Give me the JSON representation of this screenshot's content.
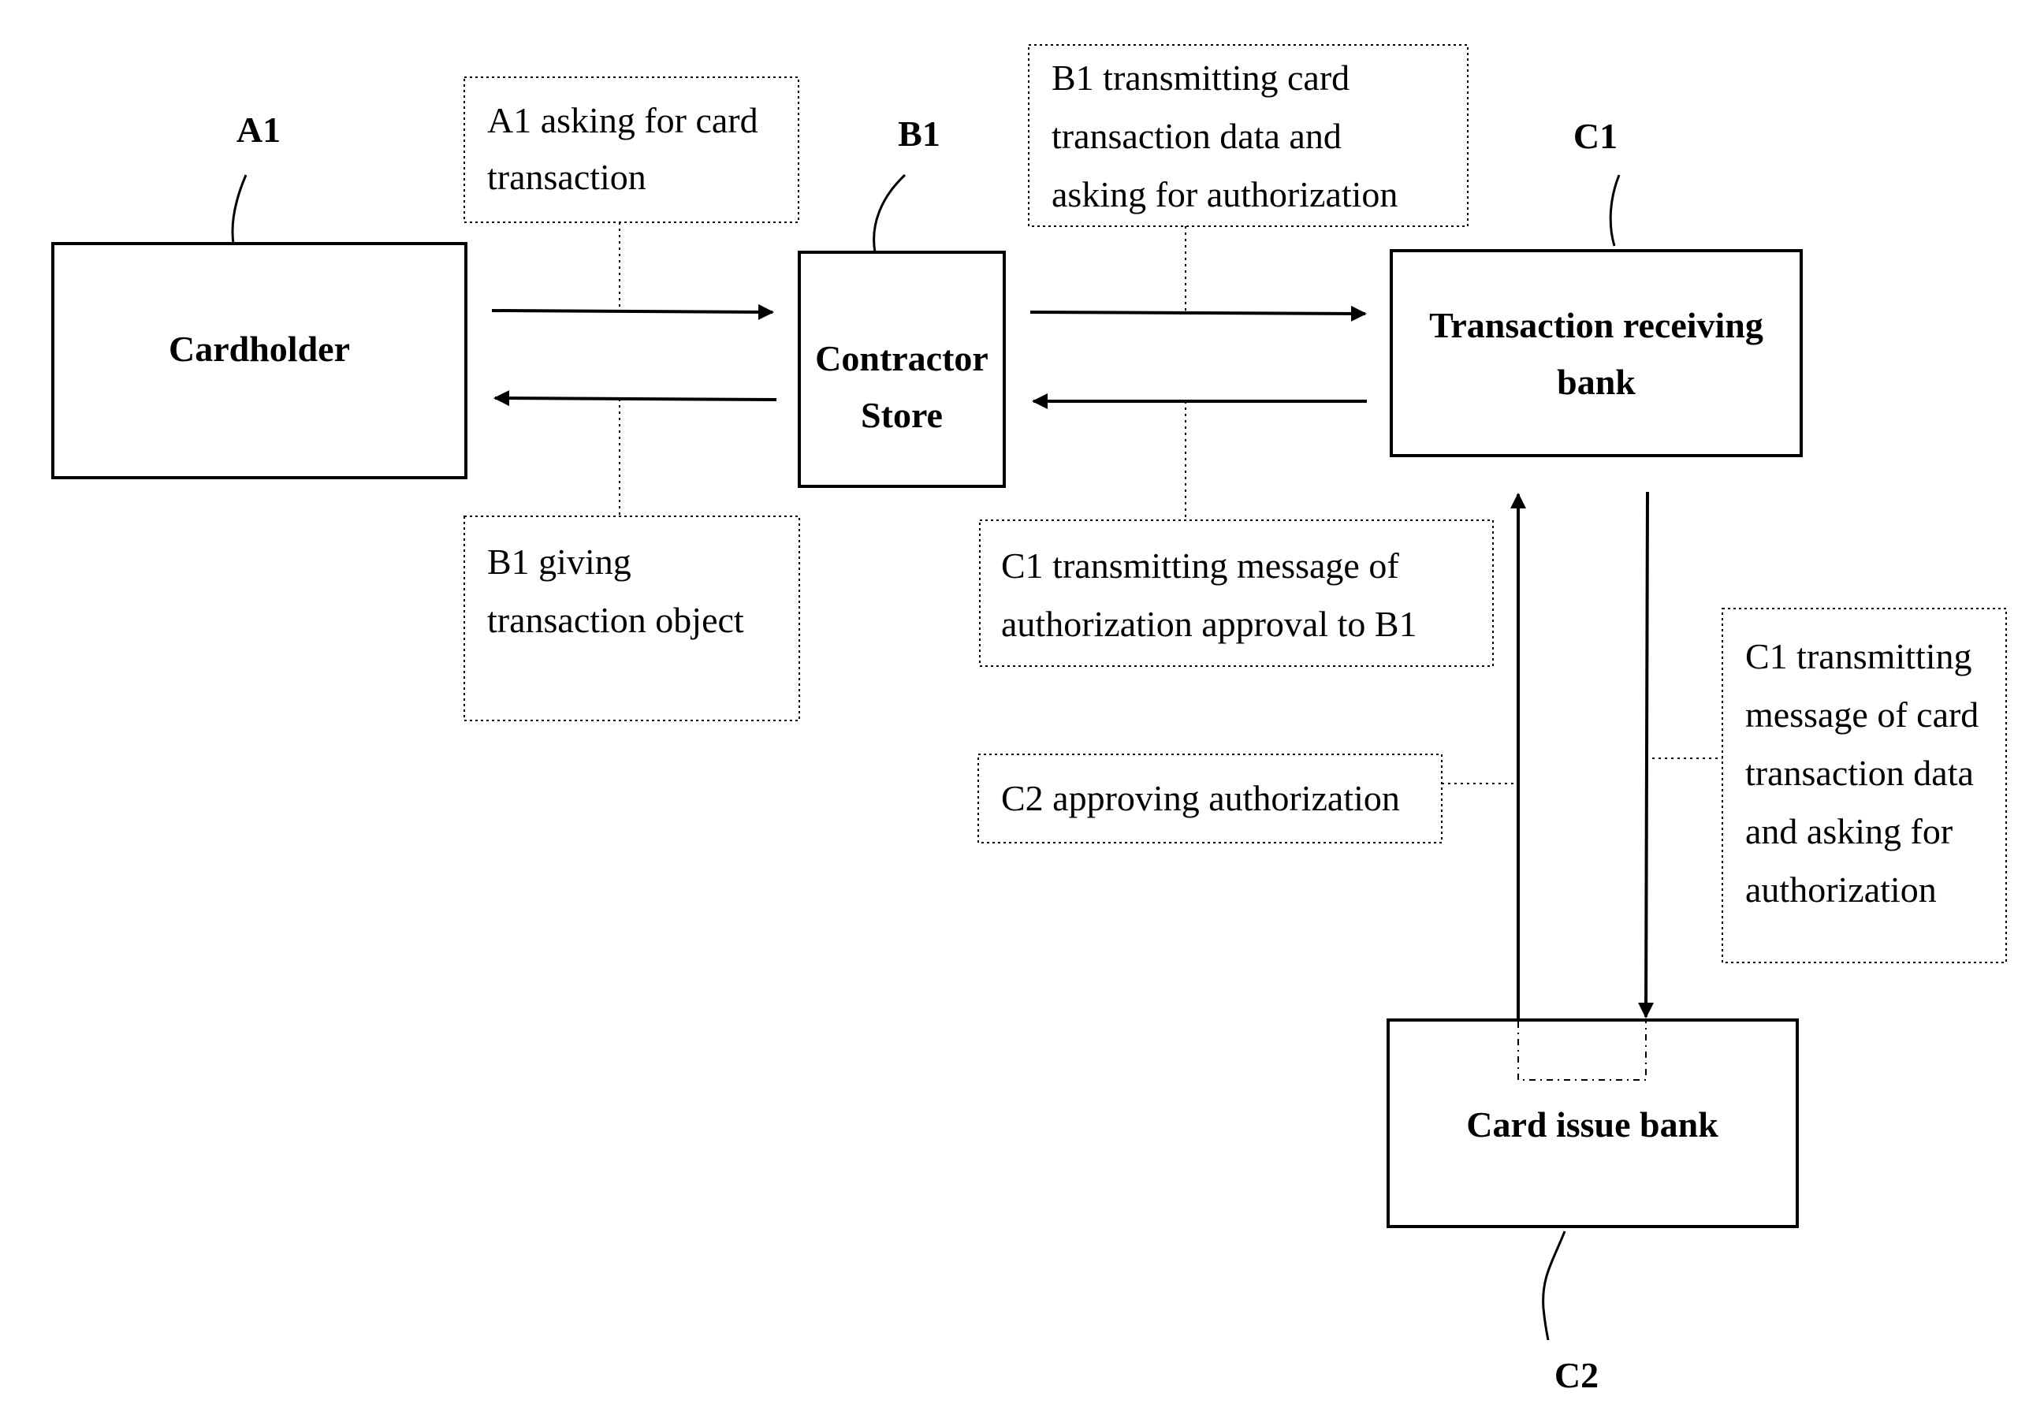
{
  "diagram": {
    "type": "flow",
    "colors": {
      "ink": "#000000",
      "background": "#ffffff"
    },
    "entities": [
      {
        "id": "A1",
        "ref": "A1",
        "lines": [
          "Cardholder"
        ]
      },
      {
        "id": "B1",
        "ref": "B1",
        "lines": [
          "Contractor",
          "Store"
        ]
      },
      {
        "id": "C1",
        "ref": "C1",
        "lines": [
          "Transaction receiving",
          "bank"
        ]
      },
      {
        "id": "C2",
        "ref": "C2",
        "lines": [
          "Card issue bank"
        ]
      }
    ],
    "messages": [
      {
        "id": "m1",
        "from": "A1",
        "to": "B1",
        "lines": [
          "A1 asking for card",
          "transaction"
        ]
      },
      {
        "id": "m2",
        "from": "B1",
        "to": "A1",
        "lines": [
          "B1 giving",
          "transaction object"
        ]
      },
      {
        "id": "m3",
        "from": "B1",
        "to": "C1",
        "lines": [
          "B1 transmitting card",
          "transaction data and",
          "asking for authorization"
        ]
      },
      {
        "id": "m4",
        "from": "C1",
        "to": "B1",
        "lines": [
          "C1 transmitting message of",
          "authorization approval to B1"
        ]
      },
      {
        "id": "m5",
        "from": "C1",
        "to": "C2",
        "lines": [
          "C1 transmitting",
          "message of card",
          "transaction data",
          "and asking for",
          "authorization"
        ]
      },
      {
        "id": "m6",
        "from": "C2",
        "to": "C1",
        "lines": [
          "C2 approving authorization"
        ]
      }
    ]
  }
}
